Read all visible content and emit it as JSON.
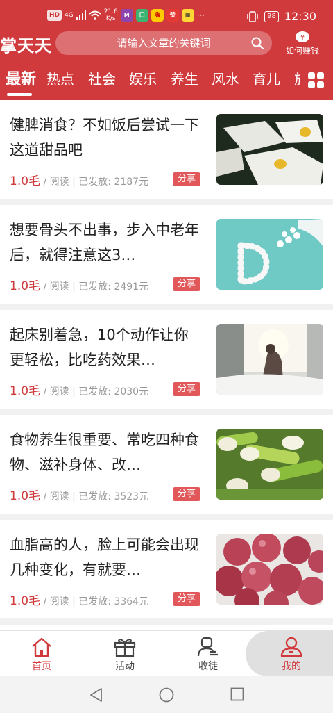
{
  "status_bar": {
    "net_speed": "21.6",
    "net_speed_unit": "K/s",
    "time": "12:30",
    "battery": "98",
    "signal_labels": [
      "HD",
      "4G"
    ]
  },
  "header": {
    "logo": "掌天天",
    "search_placeholder": "请输入文章的关键词",
    "earn_label": "如何赚钱"
  },
  "tabs": [
    "最新",
    "热点",
    "社会",
    "娱乐",
    "养生",
    "风水",
    "育儿",
    "旅"
  ],
  "articles": [
    {
      "title": "健脾消食？不如饭后尝试一下这道甜品吧",
      "price": "1.0毛",
      "meta": " / 阅读 | 已发放: 2187元",
      "share": "分享",
      "thumb": "dessert"
    },
    {
      "title": "想要骨头不出事，步入中老年后，就得注意这3…",
      "price": "1.0毛",
      "meta": " / 阅读 | 已发放: 2491元",
      "share": "分享",
      "thumb": "vitamin-d"
    },
    {
      "title": "起床别着急，10个动作让你更轻松，比吃药效果…",
      "price": "1.0毛",
      "meta": " / 阅读 | 已发放: 2030元",
      "share": "分享",
      "thumb": "morning-stretch"
    },
    {
      "title": "食物养生很重要、常吃四种食物、滋补身体、改…",
      "price": "1.0毛",
      "meta": " / 阅读 | 已发放: 3523元",
      "share": "分享",
      "thumb": "green-onions"
    },
    {
      "title": "血脂高的人，脸上可能会出现几种变化，有就要…",
      "price": "1.0毛",
      "meta": " / 阅读 | 已发放: 3364元",
      "share": "分享",
      "thumb": "grapes"
    }
  ],
  "bottom_nav": [
    {
      "label": "首页",
      "icon": "home-icon"
    },
    {
      "label": "活动",
      "icon": "gift-icon"
    },
    {
      "label": "收徒",
      "icon": "recruit-icon"
    },
    {
      "label": "我的",
      "icon": "profile-icon"
    }
  ],
  "colors": {
    "brand_red": "#d03a3d",
    "share_red": "#e2585a"
  }
}
